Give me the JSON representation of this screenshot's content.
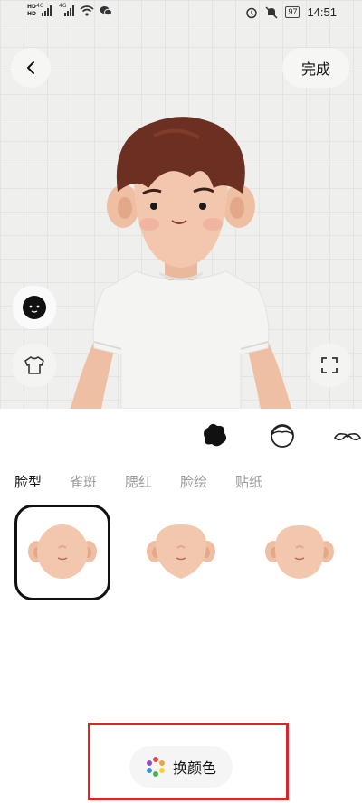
{
  "status_bar": {
    "hd_top": "HD",
    "hd_bottom": "HD",
    "network_1": "4G",
    "network_2": "4G",
    "battery": "97",
    "time": "14:51"
  },
  "header": {
    "back_icon": "chevron-left-icon",
    "done_label": "完成"
  },
  "side_tools": [
    "face-shape-icon",
    "shirt-icon",
    "fullscreen-icon"
  ],
  "category_icons": [
    "hair-blob-icon",
    "face-outline-icon",
    "mustache-icon"
  ],
  "tabs": [
    {
      "label": "脸型",
      "active": true
    },
    {
      "label": "雀斑",
      "active": false
    },
    {
      "label": "腮红",
      "active": false
    },
    {
      "label": "脸绘",
      "active": false
    },
    {
      "label": "贴纸",
      "active": false
    }
  ],
  "face_options": [
    {
      "selected": true
    },
    {
      "selected": false
    },
    {
      "selected": false
    }
  ],
  "color_button": {
    "label": "换颜色",
    "dot_colors": [
      "#e94b3c",
      "#f2a33a",
      "#f5d23a",
      "#4cb050",
      "#3d8fe0",
      "#8e4fc9"
    ]
  },
  "colors": {
    "highlight": "#d8262f",
    "skin": "#f0c4a8",
    "hair": "#6b3022",
    "shirt": "#f4f4f4"
  }
}
